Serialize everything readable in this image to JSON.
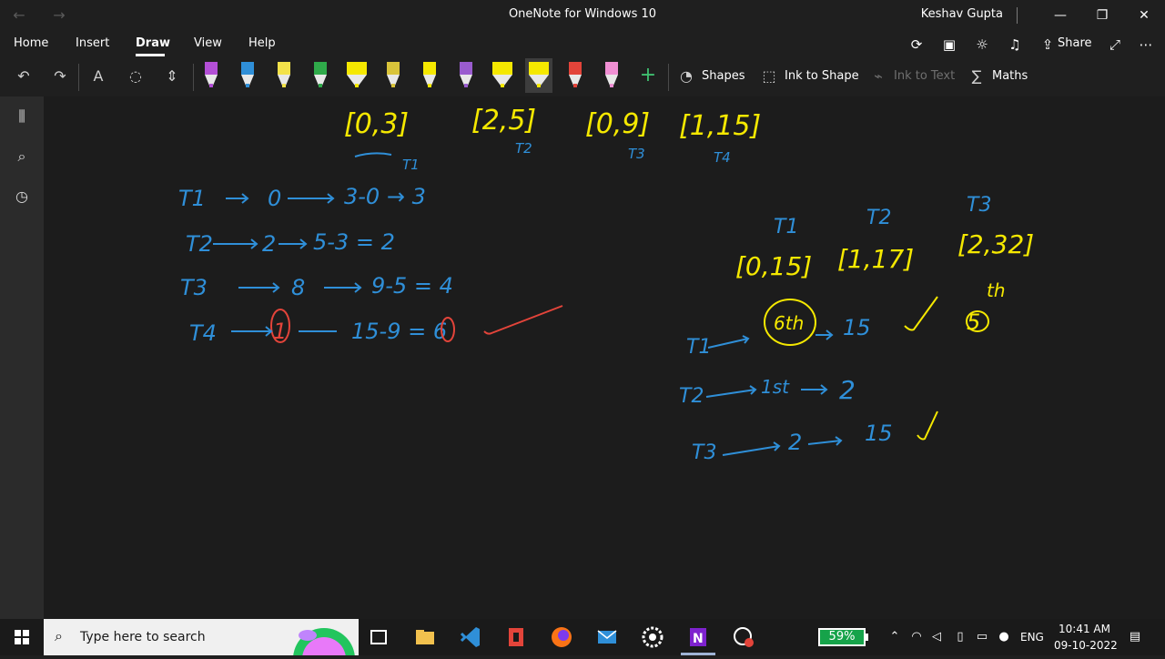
{
  "window": {
    "title": "OneNote for Windows 10",
    "user": "Keshav Gupta",
    "minimize": "—",
    "restore": "❐",
    "close": "✕"
  },
  "menu": {
    "items": [
      "Home",
      "Insert",
      "Draw",
      "View",
      "Help"
    ],
    "active": "Draw",
    "share_label": "Share"
  },
  "toolbar": {
    "shapes_label": "Shapes",
    "ink_to_shape_label": "Ink to Shape",
    "ink_to_text_label": "Ink to Text",
    "maths_label": "Maths",
    "pen_colors": [
      "#b34fd6",
      "#2f8fd8",
      "#f3e24a",
      "#2faa4a",
      "#f5e800",
      "#d9c43a",
      "#f5e800",
      "#9a5ccf",
      "#f5e800",
      "#f5e800",
      "#e3443a",
      "#f08fd3"
    ]
  },
  "notes": {
    "intervals": [
      "[0,3]",
      "[2,5]",
      "[0,9]",
      "[1,15]"
    ],
    "interval_tags": [
      "T1",
      "T2",
      "T3",
      "T4"
    ],
    "left_rows": [
      {
        "label": "T1",
        "start": "0",
        "rest": "3-0 → 3"
      },
      {
        "label": "T2",
        "start": "2",
        "rest": "5-3 = 2"
      },
      {
        "label": "T3",
        "start": "8",
        "rest": "9-5 = 4"
      },
      {
        "label": "T4",
        "start": "1",
        "rest": "15-9 = 6"
      }
    ],
    "right_tags": [
      "T1",
      "T2",
      "T3"
    ],
    "right_intervals": [
      "[0,15]",
      "[1,17]",
      "[2,32]"
    ],
    "right_note": "th",
    "right_note_value": "5",
    "right_rows": [
      {
        "label": "T1",
        "start": "6th",
        "end": "15"
      },
      {
        "label": "T2",
        "start": "1st",
        "end": "2"
      },
      {
        "label": "T3",
        "start": "2",
        "end": "15"
      }
    ]
  },
  "taskbar": {
    "search_placeholder": "Type here to search",
    "battery": "59%",
    "language": "ENG",
    "time": "10:41 AM",
    "date": "09-10-2022"
  }
}
